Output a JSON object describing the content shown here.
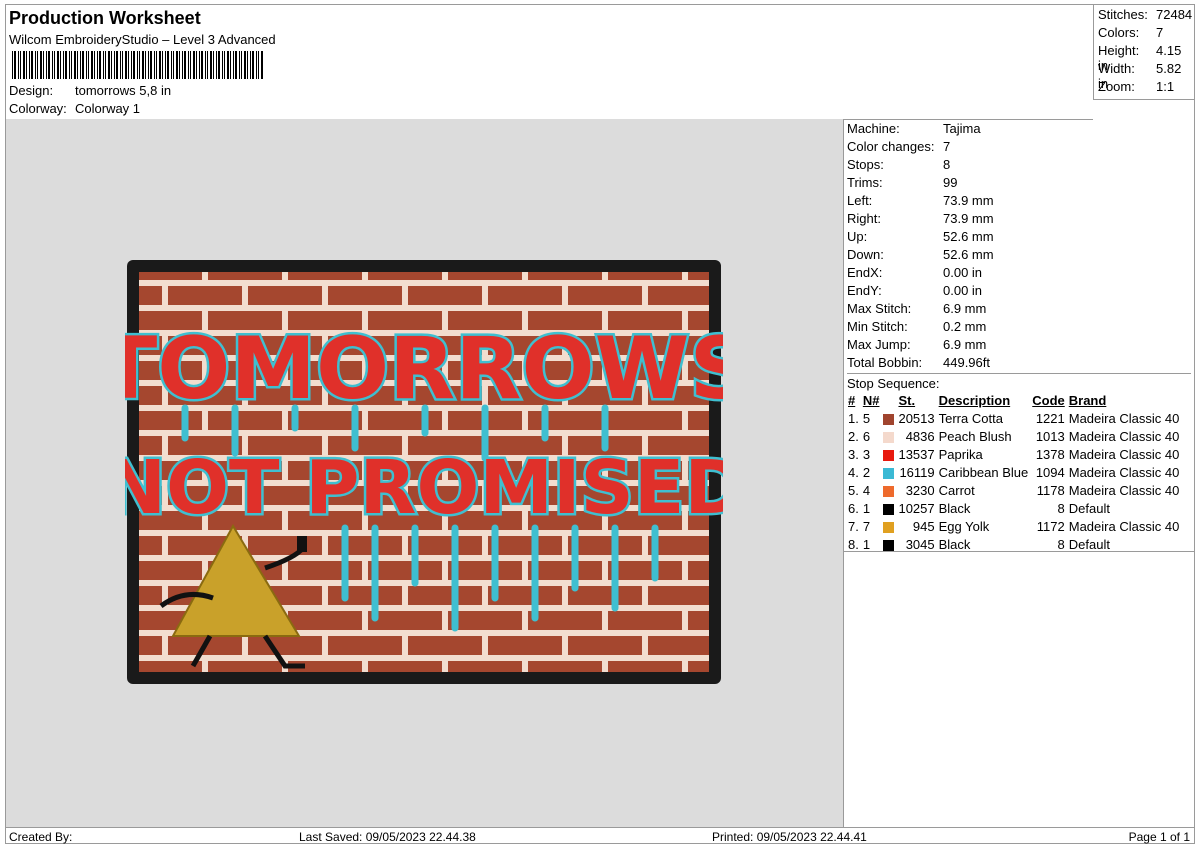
{
  "header": {
    "title": "Production Worksheet",
    "subtitle": "Wilcom EmbroideryStudio – Level 3 Advanced",
    "design_label": "Design:",
    "design_value": "tomorrows 5,8 in",
    "colorway_label": "Colorway:",
    "colorway_value": "Colorway 1"
  },
  "stats": [
    {
      "label": "Stitches:",
      "value": "72484"
    },
    {
      "label": "Colors:",
      "value": "7"
    },
    {
      "label": "Height:",
      "value": "4.15 in"
    },
    {
      "label": "Width:",
      "value": "5.82 in"
    },
    {
      "label": "Zoom:",
      "value": "1:1"
    }
  ],
  "machine_info": [
    {
      "label": "Machine:",
      "value": "Tajima"
    },
    {
      "label": "Color changes:",
      "value": "7"
    },
    {
      "label": "Stops:",
      "value": "8"
    },
    {
      "label": "Trims:",
      "value": "99"
    },
    {
      "label": "Left:",
      "value": "73.9 mm"
    },
    {
      "label": "Right:",
      "value": "73.9 mm"
    },
    {
      "label": "Up:",
      "value": "52.6 mm"
    },
    {
      "label": "Down:",
      "value": "52.6 mm"
    },
    {
      "label": "EndX:",
      "value": "0.00 in"
    },
    {
      "label": "EndY:",
      "value": "0.00 in"
    },
    {
      "label": "Max Stitch:",
      "value": "6.9 mm"
    },
    {
      "label": "Min Stitch:",
      "value": "0.2 mm"
    },
    {
      "label": "Max Jump:",
      "value": "6.9 mm"
    },
    {
      "label": "Total Bobbin:",
      "value": "449.96ft"
    }
  ],
  "stop_sequence": {
    "title": "Stop Sequence:",
    "columns": [
      "#",
      "N#",
      "St.",
      "Description",
      "Code",
      "Brand"
    ],
    "rows": [
      {
        "idx": "1.",
        "n": "5",
        "color": "#a0442e",
        "st": "20513",
        "desc": "Terra Cotta",
        "code": "1221",
        "brand": "Madeira Classic 40"
      },
      {
        "idx": "2.",
        "n": "6",
        "color": "#f4d9cc",
        "st": "4836",
        "desc": "Peach Blush",
        "code": "1013",
        "brand": "Madeira Classic 40"
      },
      {
        "idx": "3.",
        "n": "3",
        "color": "#e8190e",
        "st": "13537",
        "desc": "Paprika",
        "code": "1378",
        "brand": "Madeira Classic 40"
      },
      {
        "idx": "4.",
        "n": "2",
        "color": "#3bb9d4",
        "st": "16119",
        "desc": "Caribbean Blue",
        "code": "1094",
        "brand": "Madeira Classic 40"
      },
      {
        "idx": "5.",
        "n": "4",
        "color": "#ee6a2c",
        "st": "3230",
        "desc": "Carrot",
        "code": "1178",
        "brand": "Madeira Classic 40"
      },
      {
        "idx": "6.",
        "n": "1",
        "color": "#000000",
        "st": "10257",
        "desc": "Black",
        "code": "8",
        "brand": "Default"
      },
      {
        "idx": "7.",
        "n": "7",
        "color": "#e0a020",
        "st": "945",
        "desc": "Egg Yolk",
        "code": "1172",
        "brand": "Madeira Classic 40"
      },
      {
        "idx": "8.",
        "n": "1",
        "color": "#000000",
        "st": "3045",
        "desc": "Black",
        "code": "8",
        "brand": "Default"
      }
    ]
  },
  "patch": {
    "line1": "TOMORROWS",
    "line2": "NOT PROMISED"
  },
  "footer": {
    "created": "Created By:",
    "saved": "Last Saved: 09/05/2023 22.44.38",
    "printed": "Printed: 09/05/2023 22.44.41",
    "page": "Page 1 of 1"
  }
}
